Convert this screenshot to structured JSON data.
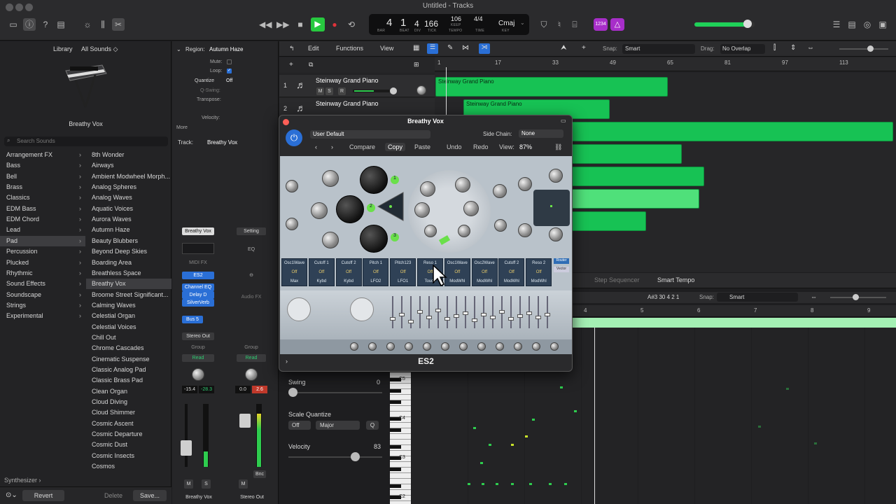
{
  "window": {
    "title": "Untitled - Tracks"
  },
  "transport": {
    "bar": "4",
    "beat": "1",
    "div": "4",
    "tick": "166",
    "labels": [
      "BAR",
      "BEAT",
      "DIV",
      "TICK"
    ],
    "tempo": "106",
    "tempo_label": "KEEP",
    "tempo_sub": "TEMPO",
    "sig_top": "4/4",
    "sig_label": "TIME",
    "key": "Cmaj",
    "key_label": "KEY",
    "lcd_badge": "1234"
  },
  "library": {
    "header": "Library",
    "filter": "All Sounds ◇",
    "preview_name": "Breathy Vox",
    "search_placeholder": "Search Sounds",
    "categories": [
      "Arrangement FX",
      "Bass",
      "Bell",
      "Brass",
      "Classics",
      "EDM Bass",
      "EDM Chord",
      "Lead",
      "Pad",
      "Percussion",
      "Plucked",
      "Rhythmic",
      "Sound Effects",
      "Soundscape",
      "Strings",
      "Experimental"
    ],
    "selected_category": "Pad",
    "patches": [
      "8th Wonder",
      "Airways",
      "Ambient Modwheel Morph...",
      "Analog Spheres",
      "Analog Waves",
      "Aquatic Voices",
      "Aurora Waves",
      "Autumn Haze",
      "Beauty Blubbers",
      "Beyond Deep Skies",
      "Boarding Area",
      "Breathless Space",
      "Breathy Vox",
      "Broome Street Significant...",
      "Calming Waves",
      "Celestial Organ",
      "Celestial Voices",
      "Chill Out",
      "Chrome Cascades",
      "Cinematic Suspense",
      "Classic Analog Pad",
      "Classic Brass Pad",
      "Clean Organ",
      "Cloud Diving",
      "Cloud Shimmer",
      "Cosmic Ascent",
      "Cosmic Departure",
      "Cosmic Dust",
      "Cosmic Insects",
      "Cosmos"
    ],
    "selected_patch": "Breathy Vox",
    "footer_path": "Synthesizer ›",
    "revert": "Revert",
    "delete": "Delete",
    "save": "Save..."
  },
  "inspector": {
    "region_label": "Region:",
    "region_name": "Autumn Haze",
    "mute_label": "Mute:",
    "loop_label": "Loop:",
    "quantize_label": "Quantize",
    "quantize_value": "Off",
    "qswing_label": "Q-Swing:",
    "transpose_label": "Transpose:",
    "velocity_label": "Velocity:",
    "more": "More",
    "track_label": "Track:",
    "track_name": "Breathy Vox",
    "strip1": {
      "setting": "Breathy Vox",
      "midi_fx": "MIDI FX",
      "instrument": "ES2",
      "fx": [
        "Channel EQ",
        "Delay D",
        "SilverVerb"
      ],
      "send": "Bus 5",
      "output": "Stereo Out",
      "group": "Group",
      "automation": "Read",
      "vol": "-15.4",
      "peak": "-28.3",
      "name": "Breathy Vox",
      "m": "M",
      "s": "S"
    },
    "strip2": {
      "setting": "Setting",
      "eq": "EQ",
      "audio_fx": "Audio FX",
      "output_label": "Stereo Out",
      "group": "Group",
      "automation": "Read",
      "vol": "0.0",
      "peak": "2.6",
      "name": "Stereo Out",
      "m": "M",
      "bnc": "Bnc"
    }
  },
  "tracks_toolbar": {
    "edit": "Edit",
    "functions": "Functions",
    "view": "View",
    "snap_label": "Snap:",
    "snap_value": "Smart",
    "drag_label": "Drag:",
    "drag_value": "No Overlap"
  },
  "ruler": [
    "1",
    "17",
    "33",
    "49",
    "65",
    "81",
    "97",
    "113"
  ],
  "track_headers": [
    {
      "num": "1",
      "name": "Steinway Grand Piano"
    },
    {
      "num": "2",
      "name": "Steinway Grand Piano"
    }
  ],
  "regions": [
    {
      "name": "Steinway Grand Piano"
    },
    {
      "name": "Steinway Grand Piano"
    }
  ],
  "plugin": {
    "title": "Breathy Vox",
    "preset": "User Default",
    "side_chain_label": "Side Chain:",
    "side_chain_value": "None",
    "compare": "Compare",
    "copy": "Copy",
    "paste": "Paste",
    "undo": "Undo",
    "redo": "Redo",
    "view_label": "View:",
    "view_value": "87%",
    "plugin_name": "ES2",
    "mod_router": [
      {
        "src": "Osc1Wave",
        "dst": "Max"
      },
      {
        "src": "Cutoff 1",
        "dst": "Kybd"
      },
      {
        "src": "Cutoff 2",
        "dst": "Kybd"
      },
      {
        "src": "Pitch 1",
        "dst": "LFO2"
      },
      {
        "src": "Pitch123",
        "dst": "LFO1"
      },
      {
        "src": "Reso 1",
        "dst": "Touch"
      },
      {
        "src": "Osc1Wave",
        "dst": "ModWhl"
      },
      {
        "src": "Osc2Wave",
        "dst": "ModWhl"
      },
      {
        "src": "Cutoff 2",
        "dst": "ModWhl"
      },
      {
        "src": "Reso 2",
        "dst": "ModWhl"
      }
    ],
    "router_off": "Off",
    "router_tab": "Router",
    "vector_tab": "Vector"
  },
  "piano_roll": {
    "tabs": [
      "Step Sequencer",
      "Smart Tempo"
    ],
    "position": "A#3  30 4 2 1",
    "snap_label": "Snap:",
    "snap_value": "Smart",
    "ruler": [
      "4",
      "5",
      "6",
      "7",
      "8",
      "9"
    ],
    "swing_label": "Swing",
    "swing_value": "0",
    "scale_quantize_label": "Scale Quantize",
    "scale_off": "Off",
    "scale_mode": "Major",
    "q": "Q",
    "velocity_label": "Velocity",
    "velocity_value": "83",
    "octaves": [
      "C5",
      "C4",
      "C3",
      "C2"
    ]
  },
  "colors": {
    "region_green": "#17c254",
    "accent_blue": "#2a6fd6",
    "plugin_panel": "#b9c2ca"
  }
}
